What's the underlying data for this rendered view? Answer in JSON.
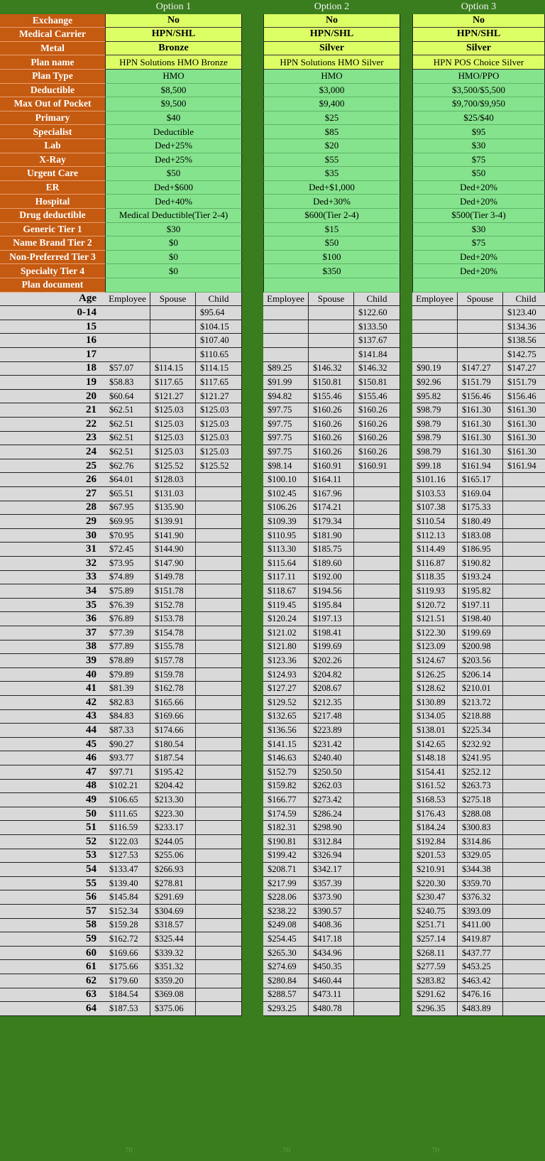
{
  "options": [
    "Option 1",
    "Option 2",
    "Option 3"
  ],
  "benefits": [
    {
      "label": "Exchange",
      "values": [
        "No",
        "No",
        "No"
      ],
      "style": "yellow"
    },
    {
      "label": "Medical Carrier",
      "values": [
        "HPN/SHL",
        "HPN/SHL",
        "HPN/SHL"
      ],
      "style": "yellow"
    },
    {
      "label": "Metal",
      "values": [
        "Bronze",
        "Silver",
        "Silver"
      ],
      "style": "yellow"
    },
    {
      "label": "Plan name",
      "values": [
        "HPN Solutions HMO Bronze",
        "HPN Solutions HMO Silver",
        "HPN POS Choice Silver"
      ],
      "style": "yellow-plain"
    },
    {
      "label": "Plan Type",
      "values": [
        "HMO",
        "HMO",
        "HMO/PPO"
      ]
    },
    {
      "label": "Deductible",
      "values": [
        "$8,500",
        "$3,000",
        "$3,500/$5,500"
      ]
    },
    {
      "label": "Max Out of Pocket",
      "values": [
        "$9,500",
        "$9,400",
        "$9,700/$9,950"
      ]
    },
    {
      "label": "Primary",
      "values": [
        "$40",
        "$25",
        "$25/$40"
      ]
    },
    {
      "label": "Specialist",
      "values": [
        "Deductible",
        "$85",
        "$95"
      ]
    },
    {
      "label": "Lab",
      "values": [
        "Ded+25%",
        "$20",
        "$30"
      ]
    },
    {
      "label": "X-Ray",
      "values": [
        "Ded+25%",
        "$55",
        "$75"
      ]
    },
    {
      "label": "Urgent Care",
      "values": [
        "$50",
        "$35",
        "$50"
      ]
    },
    {
      "label": "ER",
      "values": [
        "Ded+$600",
        "Ded+$1,000",
        "Ded+20%"
      ]
    },
    {
      "label": "Hospital",
      "values": [
        "Ded+40%",
        "Ded+30%",
        "Ded+20%"
      ]
    },
    {
      "label": "Drug deductible",
      "values": [
        "Medical Deductible(Tier 2-4)",
        "$600(Tier 2-4)",
        "$500(Tier 3-4)"
      ]
    },
    {
      "label": "Generic Tier 1",
      "values": [
        "$30",
        "$15",
        "$30"
      ]
    },
    {
      "label": "Name Brand Tier 2",
      "values": [
        "$0",
        "$50",
        "$75"
      ]
    },
    {
      "label": "Non-Preferred Tier 3",
      "values": [
        "$0",
        "$100",
        "Ded+20%"
      ]
    },
    {
      "label": "Specialty Tier 4",
      "values": [
        "$0",
        "$350",
        "Ded+20%"
      ]
    },
    {
      "label": "Plan document",
      "values": [
        "",
        "",
        ""
      ]
    }
  ],
  "rate_header": {
    "age": "Age",
    "cols": [
      "Employee",
      "Spouse",
      "Child"
    ]
  },
  "rates": [
    {
      "age": "0-14",
      "v": [
        [
          "",
          "",
          "$95.64"
        ],
        [
          "",
          "",
          "$122.60"
        ],
        [
          "",
          "",
          "$123.40"
        ]
      ]
    },
    {
      "age": "15",
      "v": [
        [
          "",
          "",
          "$104.15"
        ],
        [
          "",
          "",
          "$133.50"
        ],
        [
          "",
          "",
          "$134.36"
        ]
      ]
    },
    {
      "age": "16",
      "v": [
        [
          "",
          "",
          "$107.40"
        ],
        [
          "",
          "",
          "$137.67"
        ],
        [
          "",
          "",
          "$138.56"
        ]
      ]
    },
    {
      "age": "17",
      "v": [
        [
          "",
          "",
          "$110.65"
        ],
        [
          "",
          "",
          "$141.84"
        ],
        [
          "",
          "",
          "$142.75"
        ]
      ]
    },
    {
      "age": "18",
      "v": [
        [
          "$57.07",
          "$114.15",
          "$114.15"
        ],
        [
          "$89.25",
          "$146.32",
          "$146.32"
        ],
        [
          "$90.19",
          "$147.27",
          "$147.27"
        ]
      ]
    },
    {
      "age": "19",
      "v": [
        [
          "$58.83",
          "$117.65",
          "$117.65"
        ],
        [
          "$91.99",
          "$150.81",
          "$150.81"
        ],
        [
          "$92.96",
          "$151.79",
          "$151.79"
        ]
      ]
    },
    {
      "age": "20",
      "v": [
        [
          "$60.64",
          "$121.27",
          "$121.27"
        ],
        [
          "$94.82",
          "$155.46",
          "$155.46"
        ],
        [
          "$95.82",
          "$156.46",
          "$156.46"
        ]
      ]
    },
    {
      "age": "21",
      "v": [
        [
          "$62.51",
          "$125.03",
          "$125.03"
        ],
        [
          "$97.75",
          "$160.26",
          "$160.26"
        ],
        [
          "$98.79",
          "$161.30",
          "$161.30"
        ]
      ]
    },
    {
      "age": "22",
      "v": [
        [
          "$62.51",
          "$125.03",
          "$125.03"
        ],
        [
          "$97.75",
          "$160.26",
          "$160.26"
        ],
        [
          "$98.79",
          "$161.30",
          "$161.30"
        ]
      ]
    },
    {
      "age": "23",
      "v": [
        [
          "$62.51",
          "$125.03",
          "$125.03"
        ],
        [
          "$97.75",
          "$160.26",
          "$160.26"
        ],
        [
          "$98.79",
          "$161.30",
          "$161.30"
        ]
      ]
    },
    {
      "age": "24",
      "v": [
        [
          "$62.51",
          "$125.03",
          "$125.03"
        ],
        [
          "$97.75",
          "$160.26",
          "$160.26"
        ],
        [
          "$98.79",
          "$161.30",
          "$161.30"
        ]
      ]
    },
    {
      "age": "25",
      "v": [
        [
          "$62.76",
          "$125.52",
          "$125.52"
        ],
        [
          "$98.14",
          "$160.91",
          "$160.91"
        ],
        [
          "$99.18",
          "$161.94",
          "$161.94"
        ]
      ]
    },
    {
      "age": "26",
      "v": [
        [
          "$64.01",
          "$128.03",
          ""
        ],
        [
          "$100.10",
          "$164.11",
          ""
        ],
        [
          "$101.16",
          "$165.17",
          ""
        ]
      ]
    },
    {
      "age": "27",
      "v": [
        [
          "$65.51",
          "$131.03",
          ""
        ],
        [
          "$102.45",
          "$167.96",
          ""
        ],
        [
          "$103.53",
          "$169.04",
          ""
        ]
      ]
    },
    {
      "age": "28",
      "v": [
        [
          "$67.95",
          "$135.90",
          ""
        ],
        [
          "$106.26",
          "$174.21",
          ""
        ],
        [
          "$107.38",
          "$175.33",
          ""
        ]
      ]
    },
    {
      "age": "29",
      "v": [
        [
          "$69.95",
          "$139.91",
          ""
        ],
        [
          "$109.39",
          "$179.34",
          ""
        ],
        [
          "$110.54",
          "$180.49",
          ""
        ]
      ]
    },
    {
      "age": "30",
      "v": [
        [
          "$70.95",
          "$141.90",
          ""
        ],
        [
          "$110.95",
          "$181.90",
          ""
        ],
        [
          "$112.13",
          "$183.08",
          ""
        ]
      ]
    },
    {
      "age": "31",
      "v": [
        [
          "$72.45",
          "$144.90",
          ""
        ],
        [
          "$113.30",
          "$185.75",
          ""
        ],
        [
          "$114.49",
          "$186.95",
          ""
        ]
      ]
    },
    {
      "age": "32",
      "v": [
        [
          "$73.95",
          "$147.90",
          ""
        ],
        [
          "$115.64",
          "$189.60",
          ""
        ],
        [
          "$116.87",
          "$190.82",
          ""
        ]
      ]
    },
    {
      "age": "33",
      "v": [
        [
          "$74.89",
          "$149.78",
          ""
        ],
        [
          "$117.11",
          "$192.00",
          ""
        ],
        [
          "$118.35",
          "$193.24",
          ""
        ]
      ]
    },
    {
      "age": "34",
      "v": [
        [
          "$75.89",
          "$151.78",
          ""
        ],
        [
          "$118.67",
          "$194.56",
          ""
        ],
        [
          "$119.93",
          "$195.82",
          ""
        ]
      ]
    },
    {
      "age": "35",
      "v": [
        [
          "$76.39",
          "$152.78",
          ""
        ],
        [
          "$119.45",
          "$195.84",
          ""
        ],
        [
          "$120.72",
          "$197.11",
          ""
        ]
      ]
    },
    {
      "age": "36",
      "v": [
        [
          "$76.89",
          "$153.78",
          ""
        ],
        [
          "$120.24",
          "$197.13",
          ""
        ],
        [
          "$121.51",
          "$198.40",
          ""
        ]
      ]
    },
    {
      "age": "37",
      "v": [
        [
          "$77.39",
          "$154.78",
          ""
        ],
        [
          "$121.02",
          "$198.41",
          ""
        ],
        [
          "$122.30",
          "$199.69",
          ""
        ]
      ]
    },
    {
      "age": "38",
      "v": [
        [
          "$77.89",
          "$155.78",
          ""
        ],
        [
          "$121.80",
          "$199.69",
          ""
        ],
        [
          "$123.09",
          "$200.98",
          ""
        ]
      ]
    },
    {
      "age": "39",
      "v": [
        [
          "$78.89",
          "$157.78",
          ""
        ],
        [
          "$123.36",
          "$202.26",
          ""
        ],
        [
          "$124.67",
          "$203.56",
          ""
        ]
      ]
    },
    {
      "age": "40",
      "v": [
        [
          "$79.89",
          "$159.78",
          ""
        ],
        [
          "$124.93",
          "$204.82",
          ""
        ],
        [
          "$126.25",
          "$206.14",
          ""
        ]
      ]
    },
    {
      "age": "41",
      "v": [
        [
          "$81.39",
          "$162.78",
          ""
        ],
        [
          "$127.27",
          "$208.67",
          ""
        ],
        [
          "$128.62",
          "$210.01",
          ""
        ]
      ]
    },
    {
      "age": "42",
      "v": [
        [
          "$82.83",
          "$165.66",
          ""
        ],
        [
          "$129.52",
          "$212.35",
          ""
        ],
        [
          "$130.89",
          "$213.72",
          ""
        ]
      ]
    },
    {
      "age": "43",
      "v": [
        [
          "$84.83",
          "$169.66",
          ""
        ],
        [
          "$132.65",
          "$217.48",
          ""
        ],
        [
          "$134.05",
          "$218.88",
          ""
        ]
      ]
    },
    {
      "age": "44",
      "v": [
        [
          "$87.33",
          "$174.66",
          ""
        ],
        [
          "$136.56",
          "$223.89",
          ""
        ],
        [
          "$138.01",
          "$225.34",
          ""
        ]
      ]
    },
    {
      "age": "45",
      "v": [
        [
          "$90.27",
          "$180.54",
          ""
        ],
        [
          "$141.15",
          "$231.42",
          ""
        ],
        [
          "$142.65",
          "$232.92",
          ""
        ]
      ]
    },
    {
      "age": "46",
      "v": [
        [
          "$93.77",
          "$187.54",
          ""
        ],
        [
          "$146.63",
          "$240.40",
          ""
        ],
        [
          "$148.18",
          "$241.95",
          ""
        ]
      ]
    },
    {
      "age": "47",
      "v": [
        [
          "$97.71",
          "$195.42",
          ""
        ],
        [
          "$152.79",
          "$250.50",
          ""
        ],
        [
          "$154.41",
          "$252.12",
          ""
        ]
      ]
    },
    {
      "age": "48",
      "v": [
        [
          "$102.21",
          "$204.42",
          ""
        ],
        [
          "$159.82",
          "$262.03",
          ""
        ],
        [
          "$161.52",
          "$263.73",
          ""
        ]
      ]
    },
    {
      "age": "49",
      "v": [
        [
          "$106.65",
          "$213.30",
          ""
        ],
        [
          "$166.77",
          "$273.42",
          ""
        ],
        [
          "$168.53",
          "$275.18",
          ""
        ]
      ]
    },
    {
      "age": "50",
      "v": [
        [
          "$111.65",
          "$223.30",
          ""
        ],
        [
          "$174.59",
          "$286.24",
          ""
        ],
        [
          "$176.43",
          "$288.08",
          ""
        ]
      ]
    },
    {
      "age": "51",
      "v": [
        [
          "$116.59",
          "$233.17",
          ""
        ],
        [
          "$182.31",
          "$298.90",
          ""
        ],
        [
          "$184.24",
          "$300.83",
          ""
        ]
      ]
    },
    {
      "age": "52",
      "v": [
        [
          "$122.03",
          "$244.05",
          ""
        ],
        [
          "$190.81",
          "$312.84",
          ""
        ],
        [
          "$192.84",
          "$314.86",
          ""
        ]
      ]
    },
    {
      "age": "53",
      "v": [
        [
          "$127.53",
          "$255.06",
          ""
        ],
        [
          "$199.42",
          "$326.94",
          ""
        ],
        [
          "$201.53",
          "$329.05",
          ""
        ]
      ]
    },
    {
      "age": "54",
      "v": [
        [
          "$133.47",
          "$266.93",
          ""
        ],
        [
          "$208.71",
          "$342.17",
          ""
        ],
        [
          "$210.91",
          "$344.38",
          ""
        ]
      ]
    },
    {
      "age": "55",
      "v": [
        [
          "$139.40",
          "$278.81",
          ""
        ],
        [
          "$217.99",
          "$357.39",
          ""
        ],
        [
          "$220.30",
          "$359.70",
          ""
        ]
      ]
    },
    {
      "age": "56",
      "v": [
        [
          "$145.84",
          "$291.69",
          ""
        ],
        [
          "$228.06",
          "$373.90",
          ""
        ],
        [
          "$230.47",
          "$376.32",
          ""
        ]
      ]
    },
    {
      "age": "57",
      "v": [
        [
          "$152.34",
          "$304.69",
          ""
        ],
        [
          "$238.22",
          "$390.57",
          ""
        ],
        [
          "$240.75",
          "$393.09",
          ""
        ]
      ]
    },
    {
      "age": "58",
      "v": [
        [
          "$159.28",
          "$318.57",
          ""
        ],
        [
          "$249.08",
          "$408.36",
          ""
        ],
        [
          "$251.71",
          "$411.00",
          ""
        ]
      ]
    },
    {
      "age": "59",
      "v": [
        [
          "$162.72",
          "$325.44",
          ""
        ],
        [
          "$254.45",
          "$417.18",
          ""
        ],
        [
          "$257.14",
          "$419.87",
          ""
        ]
      ]
    },
    {
      "age": "60",
      "v": [
        [
          "$169.66",
          "$339.32",
          ""
        ],
        [
          "$265.30",
          "$434.96",
          ""
        ],
        [
          "$268.11",
          "$437.77",
          ""
        ]
      ]
    },
    {
      "age": "61",
      "v": [
        [
          "$175.66",
          "$351.32",
          ""
        ],
        [
          "$274.69",
          "$450.35",
          ""
        ],
        [
          "$277.59",
          "$453.25",
          ""
        ]
      ]
    },
    {
      "age": "62",
      "v": [
        [
          "$179.60",
          "$359.20",
          ""
        ],
        [
          "$280.84",
          "$460.44",
          ""
        ],
        [
          "$283.82",
          "$463.42",
          ""
        ]
      ]
    },
    {
      "age": "63",
      "v": [
        [
          "$184.54",
          "$369.08",
          ""
        ],
        [
          "$288.57",
          "$473.11",
          ""
        ],
        [
          "$291.62",
          "$476.16",
          ""
        ]
      ]
    },
    {
      "age": "64",
      "v": [
        [
          "$187.53",
          "$375.06",
          ""
        ],
        [
          "$293.25",
          "$480.78",
          ""
        ],
        [
          "$296.35",
          "$483.89",
          ""
        ]
      ]
    }
  ],
  "footer_notes": [
    "70",
    "70",
    "70"
  ],
  "colors": {
    "label_bg": "#c55a11",
    "sheet_green": "#3a7d1e",
    "cell_green": "#84e38c",
    "cell_yellow": "#ddff66",
    "rate_gray": "#d9d9d9"
  }
}
